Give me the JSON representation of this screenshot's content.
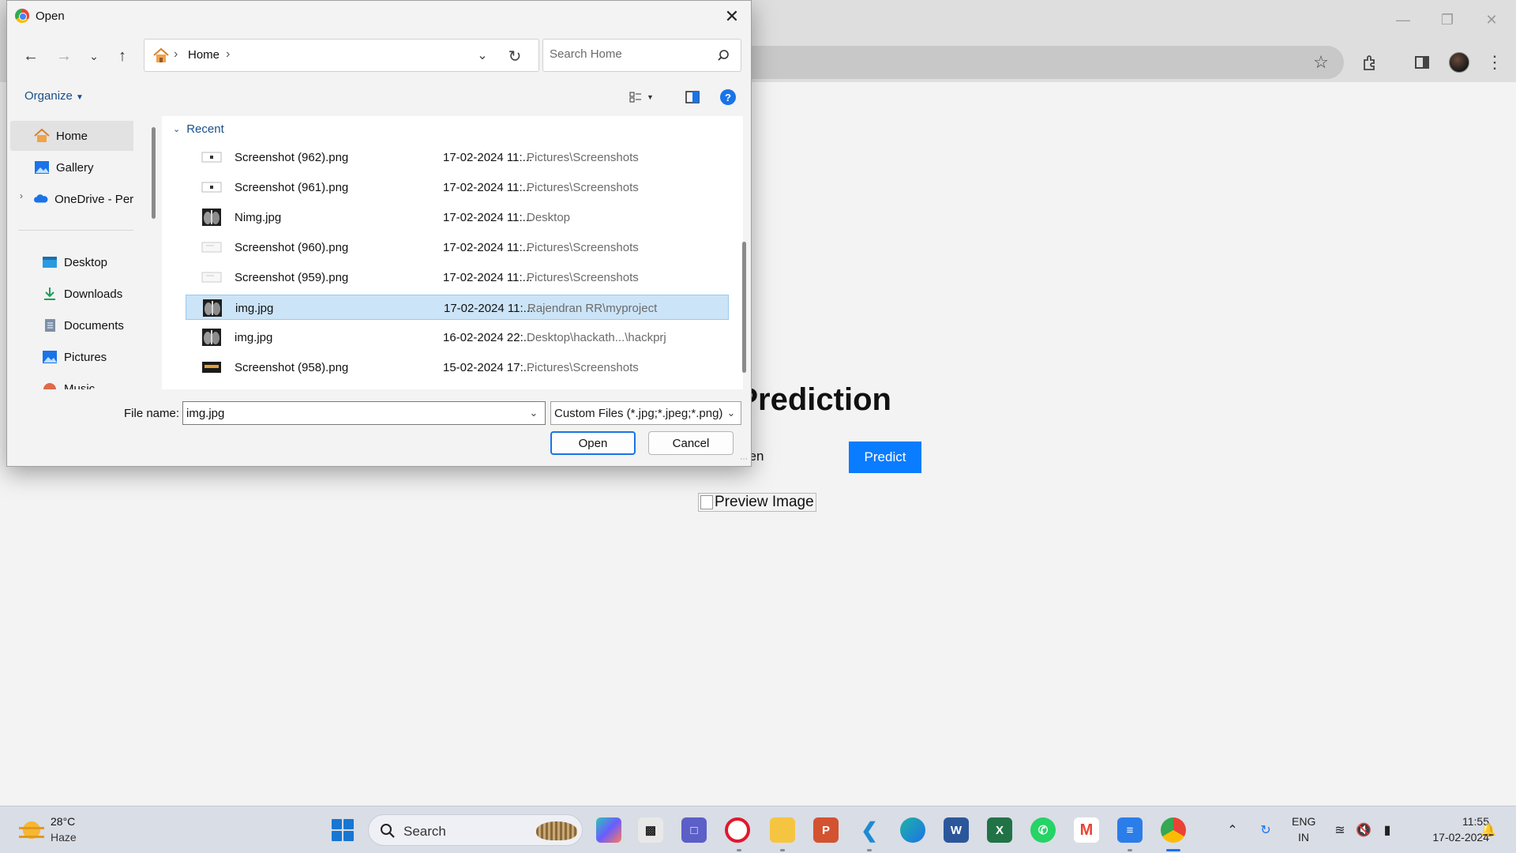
{
  "dialog": {
    "title": "Open",
    "breadcrumb": {
      "location": "Home"
    },
    "search": {
      "placeholder": "Search Home"
    },
    "organize_label": "Organize",
    "sidebar": {
      "items": [
        {
          "label": "Home",
          "icon": "home-icon",
          "selected": true
        },
        {
          "label": "Gallery",
          "icon": "gallery-icon"
        },
        {
          "label": "OneDrive - Perso",
          "icon": "cloud-icon"
        },
        {
          "label": "Desktop",
          "icon": "desktop-icon",
          "pinned": true
        },
        {
          "label": "Downloads",
          "icon": "download-icon",
          "pinned": true
        },
        {
          "label": "Documents",
          "icon": "document-icon",
          "pinned": true
        },
        {
          "label": "Pictures",
          "icon": "pictures-icon",
          "pinned": true
        },
        {
          "label": "Music",
          "icon": "music-icon",
          "pinned": true
        }
      ]
    },
    "group_header": "Recent",
    "files": [
      {
        "name": "Screenshot (962).png",
        "date": "17-02-2024 11:...",
        "location": "Pictures\\Screenshots",
        "thumb": "screenshot-thumb"
      },
      {
        "name": "Screenshot (961).png",
        "date": "17-02-2024 11:...",
        "location": "Pictures\\Screenshots",
        "thumb": "screenshot-thumb"
      },
      {
        "name": "Nimg.jpg",
        "date": "17-02-2024 11:...",
        "location": "Desktop",
        "thumb": "xray-thumb"
      },
      {
        "name": "Screenshot (960).png",
        "date": "17-02-2024 11:...",
        "location": "Pictures\\Screenshots",
        "thumb": "blank-thumb"
      },
      {
        "name": "Screenshot (959).png",
        "date": "17-02-2024 11:...",
        "location": "Pictures\\Screenshots",
        "thumb": "blank-thumb"
      },
      {
        "name": "img.jpg",
        "date": "17-02-2024 11:...",
        "location": "Rajendran RR\\myproject",
        "thumb": "xray-thumb",
        "selected": true
      },
      {
        "name": "img.jpg",
        "date": "16-02-2024 22:...",
        "location": "Desktop\\hackath...\\hackprj",
        "thumb": "xray-thumb"
      },
      {
        "name": "Screenshot (958).png",
        "date": "15-02-2024 17:...",
        "location": "Pictures\\Screenshots",
        "thumb": "dark-thumb"
      }
    ],
    "file_name_label": "File name:",
    "file_name_value": "img.jpg",
    "file_type": "Custom Files (*.jpg;*.jpeg;*.png)",
    "open_label": "Open",
    "cancel_label": "Cancel"
  },
  "page": {
    "title_partial": "a Prediction",
    "choose_partial": "sen",
    "predict_label": "Predict",
    "preview_alt": "Preview Image",
    "accent": "#0a7cff"
  },
  "taskbar": {
    "weather_temp": "28°C",
    "weather_desc": "Haze",
    "search_label": "Search",
    "apps": [
      "copilot-icon",
      "terminal-icon",
      "chat-icon",
      "opera-icon",
      "file-explorer-icon",
      "powerpoint-icon",
      "vscode-icon",
      "edge-icon",
      "word-icon",
      "excel-icon",
      "whatsapp-icon",
      "gmail-icon",
      "notepad-icon",
      "chrome-icon"
    ],
    "lang_top": "ENG",
    "lang_bottom": "IN",
    "time": "11:55",
    "date": "17-02-2024"
  }
}
